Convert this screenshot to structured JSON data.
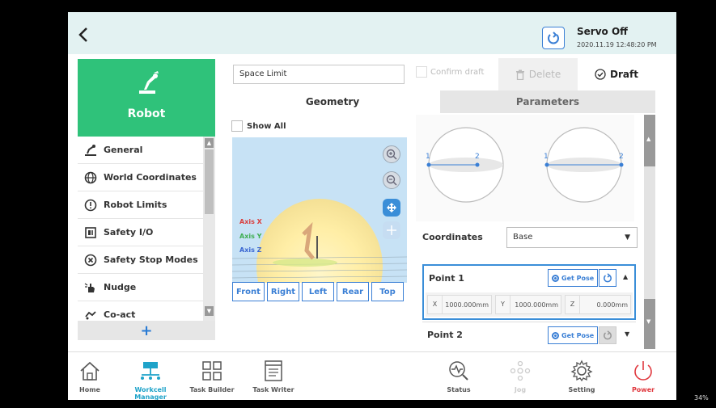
{
  "header": {
    "servo_status": "Servo Off",
    "datetime": "2020.11.19 12:48:20 PM"
  },
  "sidebar": {
    "title": "Robot",
    "items": [
      {
        "label": "General",
        "icon": "robot-arm-icon"
      },
      {
        "label": "World Coordinates",
        "icon": "globe-coordinates-icon"
      },
      {
        "label": "Robot Limits",
        "icon": "exclamation-circle-icon"
      },
      {
        "label": "Safety I/O",
        "icon": "io-port-icon"
      },
      {
        "label": "Safety Stop Modes",
        "icon": "x-circle-icon"
      },
      {
        "label": "Nudge",
        "icon": "hand-push-icon"
      },
      {
        "label": "Co-act",
        "icon": "handshake-icon"
      }
    ],
    "add_label": "+"
  },
  "editor": {
    "title_value": "Space Limit",
    "confirm_draft": "Confirm draft",
    "delete": "Delete",
    "draft": "Draft",
    "tabs": [
      "Geometry",
      "Parameters"
    ],
    "show_all": "Show All",
    "axis_labels": [
      "Axis X",
      "Axis Y",
      "Axis Z"
    ],
    "view_buttons": [
      "Front",
      "Right",
      "Left",
      "Rear",
      "Top"
    ],
    "sphere_points": [
      "1",
      "2",
      "1",
      "2"
    ]
  },
  "parameters": {
    "coordinates_label": "Coordinates",
    "coordinates_value": "Base",
    "point1": {
      "label": "Point 1",
      "get_pose": "Get Pose",
      "x_axis": "X",
      "x_value": "1000.000",
      "y_axis": "Y",
      "y_value": "1000.000",
      "z_axis": "Z",
      "z_value": "0.000",
      "unit": "mm"
    },
    "point2": {
      "label": "Point 2",
      "get_pose": "Get Pose"
    }
  },
  "bottom_nav": [
    {
      "label": "Home",
      "active": false,
      "disabled": false
    },
    {
      "label": "Workcell Manager",
      "active": true,
      "disabled": false
    },
    {
      "label": "Task Builder",
      "active": false,
      "disabled": false
    },
    {
      "label": "Task Writer",
      "active": false,
      "disabled": false
    },
    {
      "label": "Status",
      "active": false,
      "disabled": false
    },
    {
      "label": "Jog",
      "active": false,
      "disabled": true
    },
    {
      "label": "Setting",
      "active": false,
      "disabled": false
    },
    {
      "label": "Power",
      "active": false,
      "disabled": false
    }
  ],
  "colors": {
    "accent": "#3a7fd5",
    "robot_green": "#2fc27a",
    "header_bg": "#e3f2f2",
    "active_nav": "#1fa3c9",
    "power_red": "#e0383e"
  },
  "zoom_overlay": "34%"
}
